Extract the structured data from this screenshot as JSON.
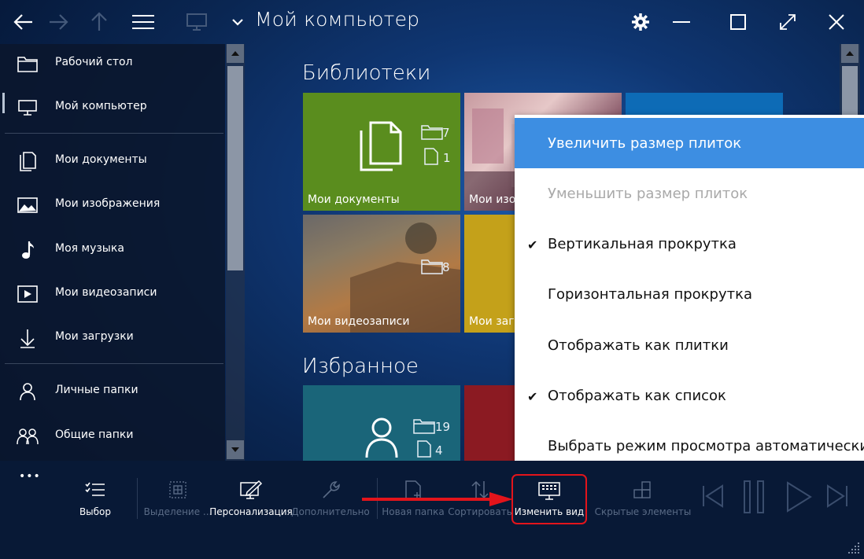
{
  "window": {
    "title": "Мой компьютер"
  },
  "sidebar": {
    "items": [
      {
        "label": "Рабочий стол",
        "icon": "folder-icon"
      },
      {
        "label": "Мой компьютер",
        "icon": "monitor-icon"
      },
      {
        "label": "Мои документы",
        "icon": "documents-icon"
      },
      {
        "label": "Мои изображения",
        "icon": "image-icon"
      },
      {
        "label": "Моя музыка",
        "icon": "music-note-icon"
      },
      {
        "label": "Мои видеозаписи",
        "icon": "video-play-icon"
      },
      {
        "label": "Мои загрузки",
        "icon": "download-arrow-icon"
      },
      {
        "label": "Личные папки",
        "icon": "person-icon"
      },
      {
        "label": "Общие папки",
        "icon": "people-icon"
      }
    ],
    "more": "•••"
  },
  "content": {
    "libraries_title": "Библиотеки",
    "favorites_title": "Избранное",
    "tiles": {
      "documents": {
        "label": "Мои документы",
        "folders": "7",
        "files": "1",
        "color": "#5a8d1e"
      },
      "images": {
        "label": "Мои изо"
      },
      "videos": {
        "label": "Мои видеозаписи",
        "folders": "8"
      },
      "music": {
        "label": "Мои загр",
        "color": "#c4a11a"
      },
      "personal": {
        "folders": "19",
        "files": "4",
        "color": "#1a6579"
      },
      "shared": {
        "color": "#8b1a22"
      },
      "third_library": {
        "color": "#0d6bb6"
      }
    }
  },
  "context_menu": {
    "items": [
      {
        "label": "Увеличить размер плиток",
        "state": "highlighted",
        "checked": ""
      },
      {
        "label": "Уменьшить размер плиток",
        "state": "disabled",
        "checked": ""
      },
      {
        "label": "Вертикальная прокрутка",
        "state": "normal",
        "checked": "✔"
      },
      {
        "label": "Горизонтальная прокрутка",
        "state": "normal",
        "checked": ""
      },
      {
        "label": "Отображать как плитки",
        "state": "normal",
        "checked": ""
      },
      {
        "label": "Отображать как список",
        "state": "normal",
        "checked": "✔"
      },
      {
        "label": "Выбрать режим просмотра автоматически",
        "state": "normal",
        "checked": ""
      }
    ],
    "highlight_color": "#3d8ee2"
  },
  "toolbar": {
    "select": "Выбор",
    "select_all": "Выделение ...",
    "personalize": "Персонализация",
    "advanced": "Дополнительно",
    "new_folder": "Новая папка",
    "sort": "Сортировать",
    "change_view": "Изменить вид",
    "hidden_items": "Скрытые элементы"
  },
  "annotation": {
    "arrow_color": "#e3141b",
    "highlight_box_color": "#e3141b"
  }
}
